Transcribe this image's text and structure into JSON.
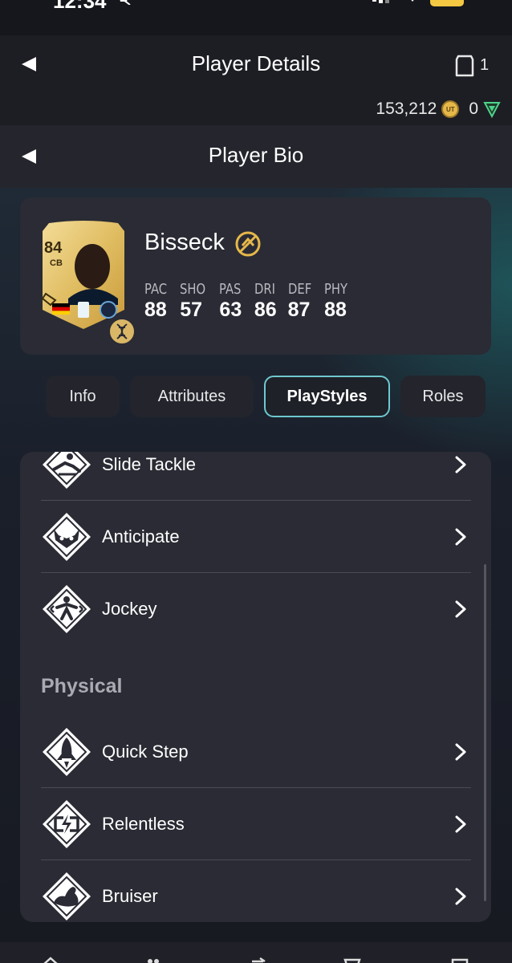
{
  "status_bar": {
    "time": "12:34"
  },
  "header": {
    "title": "Player Details",
    "pack_count": "1",
    "coins": "153,212",
    "points": "0"
  },
  "subheader": {
    "title": "Player Bio"
  },
  "player": {
    "name": "Bisseck",
    "rating": "84",
    "position": "CB",
    "stats": [
      {
        "label": "PAC",
        "value": "88"
      },
      {
        "label": "SHO",
        "value": "57"
      },
      {
        "label": "PAS",
        "value": "63"
      },
      {
        "label": "DRI",
        "value": "86"
      },
      {
        "label": "DEF",
        "value": "87"
      },
      {
        "label": "PHY",
        "value": "88"
      }
    ]
  },
  "tabs": [
    {
      "label": "Info"
    },
    {
      "label": "Attributes"
    },
    {
      "label": "PlayStyles",
      "active": true
    },
    {
      "label": "Roles"
    }
  ],
  "playstyles": {
    "defending_items": [
      {
        "label": "Slide Tackle",
        "icon": "slide-tackle-icon"
      },
      {
        "label": "Anticipate",
        "icon": "anticipate-icon"
      },
      {
        "label": "Jockey",
        "icon": "jockey-icon"
      }
    ],
    "physical_title": "Physical",
    "physical_items": [
      {
        "label": "Quick Step",
        "icon": "quick-step-icon"
      },
      {
        "label": "Relentless",
        "icon": "relentless-icon"
      },
      {
        "label": "Bruiser",
        "icon": "bruiser-icon"
      }
    ]
  },
  "colors": {
    "background": "#16171c",
    "panel": "#2a2b34",
    "active_tab_border": "#6fc8cf",
    "gold": "#e6b84a"
  }
}
